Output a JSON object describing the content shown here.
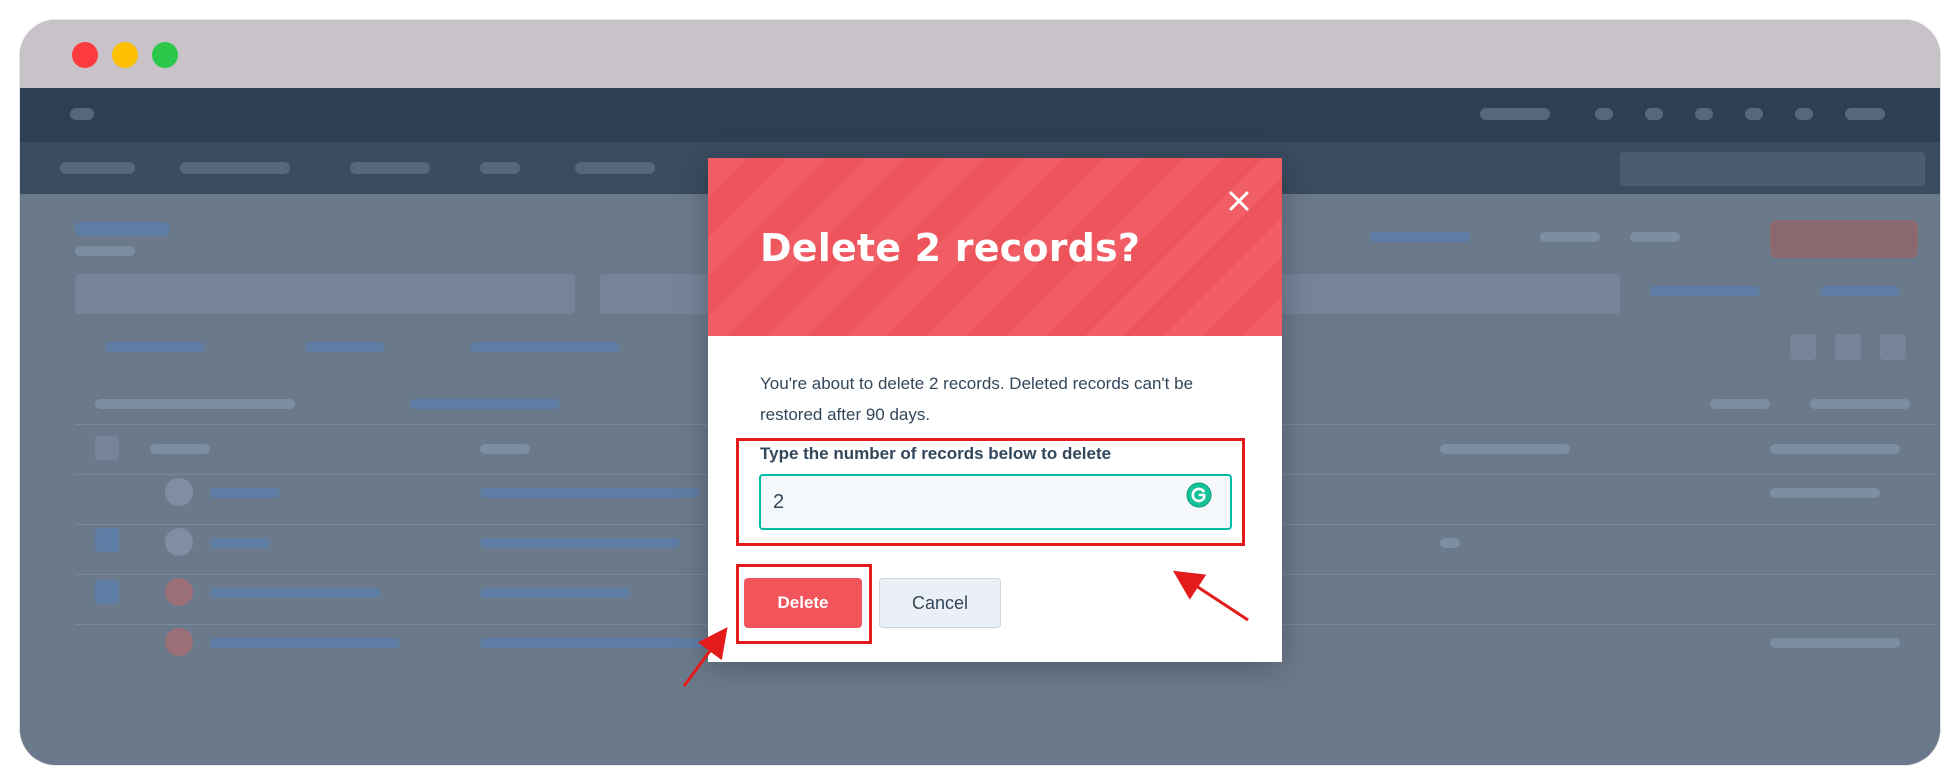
{
  "modal": {
    "title": "Delete 2 records?",
    "description": "You're about to delete 2 records. Deleted records can't be restored after 90 days.",
    "field_label": "Type the number of records below to delete",
    "field_value": "2",
    "delete_label": "Delete",
    "cancel_label": "Cancel"
  },
  "icons": {
    "close": "close-icon",
    "grammarly": "grammarly-icon"
  },
  "colors": {
    "header_red": "#f05d64",
    "delete_red": "#f2545b",
    "input_border": "#00bda5",
    "annotation_red": "#e41b1b"
  }
}
